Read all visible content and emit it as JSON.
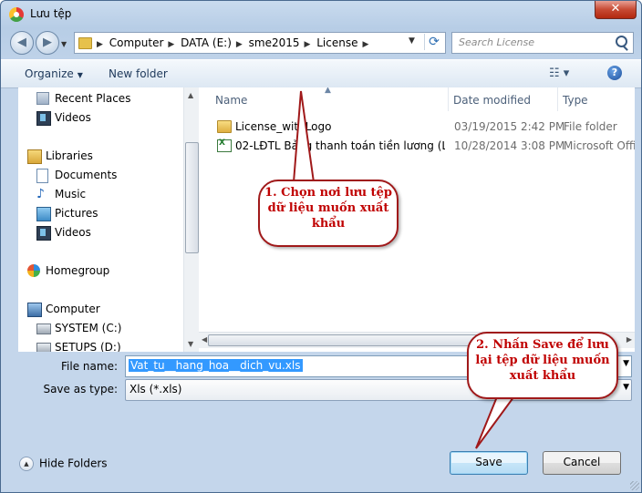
{
  "window": {
    "title": "Lưu tệp",
    "close_label": "✕"
  },
  "nav": {
    "back_icon": "back-arrow-icon",
    "forward_icon": "forward-arrow-icon",
    "breadcrumbs": [
      "Computer",
      "DATA (E:)",
      "sme2015",
      "License"
    ],
    "search_placeholder": "Search License"
  },
  "toolbar": {
    "organize_label": "Organize",
    "new_folder_label": "New folder"
  },
  "sidebar": {
    "items": [
      {
        "label": "Recent Places",
        "icon": "recent-places-icon"
      },
      {
        "label": "Videos",
        "icon": "videos-icon"
      },
      {
        "label": "Libraries",
        "icon": "libraries-icon"
      },
      {
        "label": "Documents",
        "icon": "documents-icon"
      },
      {
        "label": "Music",
        "icon": "music-icon"
      },
      {
        "label": "Pictures",
        "icon": "pictures-icon"
      },
      {
        "label": "Videos",
        "icon": "videos-icon"
      },
      {
        "label": "Homegroup",
        "icon": "homegroup-icon"
      },
      {
        "label": "Computer",
        "icon": "computer-icon"
      },
      {
        "label": "SYSTEM (C:)",
        "icon": "drive-icon"
      },
      {
        "label": "SETUPS (D:)",
        "icon": "drive-icon"
      }
    ]
  },
  "files": {
    "columns": [
      "Name",
      "Date modified",
      "Type"
    ],
    "rows": [
      {
        "name": "License_withLogo",
        "date": "03/19/2015 2:42 PM",
        "type": "File folder",
        "icon": "folder-icon"
      },
      {
        "name": "02-LĐTL Bảng thanh toán tiền lương (Lư...",
        "date": "10/28/2014 3:08 PM",
        "type": "Microsoft Offic",
        "icon": "excel-file-icon"
      }
    ]
  },
  "form": {
    "file_name_label": "File name:",
    "file_name_value": "Vat_tu__hang_hoa__dich_vu.xls",
    "save_type_label": "Save as type:",
    "save_type_value": "Xls (*.xls)"
  },
  "footer": {
    "hide_folders_label": "Hide Folders",
    "save_label": "Save",
    "cancel_label": "Cancel"
  },
  "annotations": {
    "callout1": [
      "1. Chọn nơi lưu tệp",
      "dữ liệu muốn xuất",
      "khẩu"
    ],
    "callout2": [
      "2. Nhấn Save để lưu",
      "lại tệp dữ liệu muốn",
      "xuất khẩu"
    ]
  },
  "colors": {
    "callout_text": "#c00000",
    "callout_border": "#a0191a",
    "selection": "#3399ff"
  }
}
